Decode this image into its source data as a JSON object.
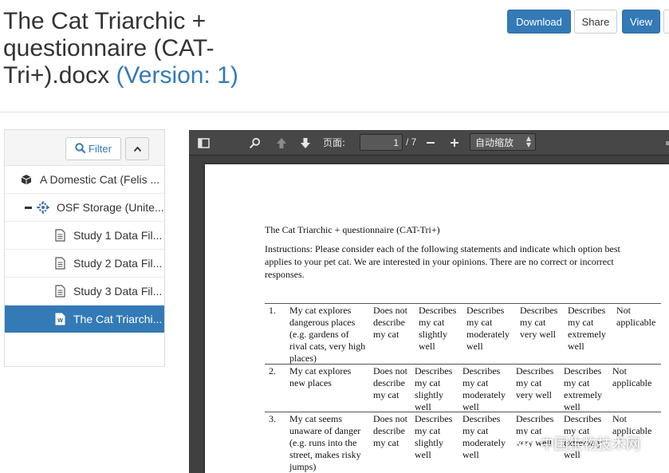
{
  "header": {
    "title": "The Cat Triarchic + questionnaire (CAT-Tri+).docx",
    "version": "(Version: 1)",
    "buttons": {
      "download": "Download",
      "share": "Share",
      "view": "View"
    }
  },
  "sidebar": {
    "filter_label": "Filter",
    "items": [
      {
        "label": "A Domestic Cat (Felis ...",
        "icon": "cube-icon"
      },
      {
        "label": "OSF Storage (Unite...",
        "icon": "storage-icon"
      },
      {
        "label": "Study 1 Data Fil...",
        "icon": "file-icon"
      },
      {
        "label": "Study 2 Data Fil...",
        "icon": "file-icon"
      },
      {
        "label": "Study 3 Data Fil...",
        "icon": "file-icon"
      },
      {
        "label": "The Cat Triarchi...",
        "icon": "word-file-icon"
      }
    ]
  },
  "viewer": {
    "page_label": "页面:",
    "current_page": "1",
    "total_pages": "/ 7",
    "zoom": "自动缩放"
  },
  "document": {
    "title": "The Cat Triarchic + questionnaire (CAT-Tri+)",
    "instructions": "Instructions: Please consider each of the following statements and indicate which option best applies to your pet cat. We are interested in your opinions. There are no correct or incorrect responses.",
    "rows": [
      {
        "num": "1.",
        "statement": "My cat explores dangerous places (e.g. gardens of rival cats, very high places)",
        "options": [
          "Does not describe my cat",
          "Describes my cat slightly well",
          "Describes my cat moderately well",
          "Describes my cat very well",
          "Describes my cat extremely well",
          "Not applicable"
        ]
      },
      {
        "num": "2.",
        "statement": "My cat explores new places",
        "options": [
          "Does not describe my cat",
          "Describes my cat slightly well",
          "Describes my cat moderately well",
          "Describes my cat very well",
          "Describes my cat extremely well",
          "Not applicable"
        ]
      },
      {
        "num": "3.",
        "statement": "My cat seems unaware of danger (e.g. runs into the street, makes risky jumps)",
        "options": [
          "Does not describe my cat",
          "Describes my cat slightly well",
          "Describes my cat moderately well",
          "Describes my cat very well",
          "Describes my cat extremely well",
          "Not applicable"
        ]
      }
    ]
  },
  "watermark": "中国生物技术网",
  "colors": {
    "primary": "#337ab7",
    "selected_bg": "#337ab7",
    "toolbar": "#474747",
    "viewer_bg": "#404040"
  }
}
